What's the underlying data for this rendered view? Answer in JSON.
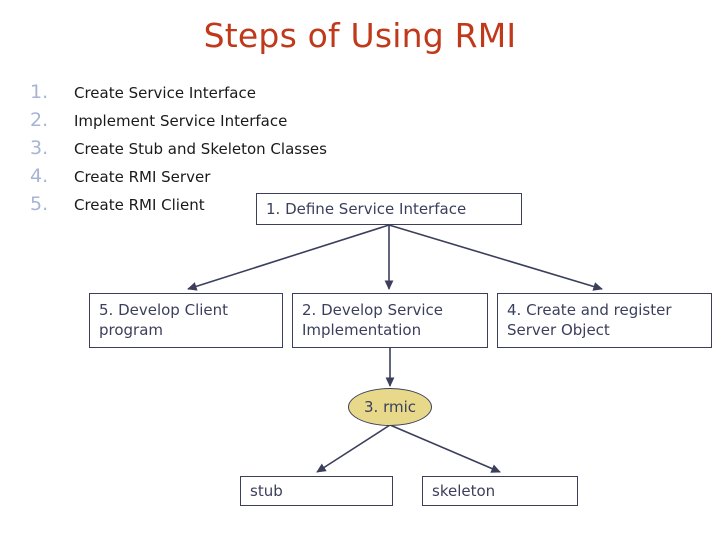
{
  "slide": {
    "title": "Steps of Using RMI",
    "title_color": "#c0391b",
    "background": "#ffffff"
  },
  "steps": {
    "number_color": "#a7b4d4",
    "text_color": "#1a1a1a",
    "items": [
      {
        "number": "1.",
        "label": "Create Service Interface"
      },
      {
        "number": "2.",
        "label": "Implement Service Interface"
      },
      {
        "number": "3.",
        "label": "Create Stub and Skeleton Classes"
      },
      {
        "number": "4.",
        "label": "Create RMI Server"
      },
      {
        "number": "5.",
        "label": "Create RMI Client"
      }
    ]
  },
  "diagram": {
    "line_color": "#3b3f5c",
    "box_fill": "#ffffff",
    "ellipse_fill": "#e8d98a",
    "nodes": [
      {
        "id": "define",
        "shape": "rect",
        "line1": "1. Define Service Interface",
        "line2": ""
      },
      {
        "id": "client",
        "shape": "rect",
        "line1": "5. Develop Client",
        "line2": "program"
      },
      {
        "id": "service",
        "shape": "rect",
        "line1": "2. Develop Service",
        "line2": "Implementation"
      },
      {
        "id": "register",
        "shape": "rect",
        "line1": "4. Create and register",
        "line2": "Server Object"
      },
      {
        "id": "rmic",
        "shape": "ellipse",
        "line1": "3. rmic",
        "line2": ""
      },
      {
        "id": "stub",
        "shape": "rect",
        "line1": "stub",
        "line2": ""
      },
      {
        "id": "skeleton",
        "shape": "rect",
        "line1": "skeleton",
        "line2": ""
      }
    ],
    "edges": [
      {
        "from": "define",
        "to": "client"
      },
      {
        "from": "define",
        "to": "service"
      },
      {
        "from": "define",
        "to": "register"
      },
      {
        "from": "service",
        "to": "rmic"
      },
      {
        "from": "rmic",
        "to": "stub"
      },
      {
        "from": "rmic",
        "to": "skeleton"
      }
    ]
  }
}
